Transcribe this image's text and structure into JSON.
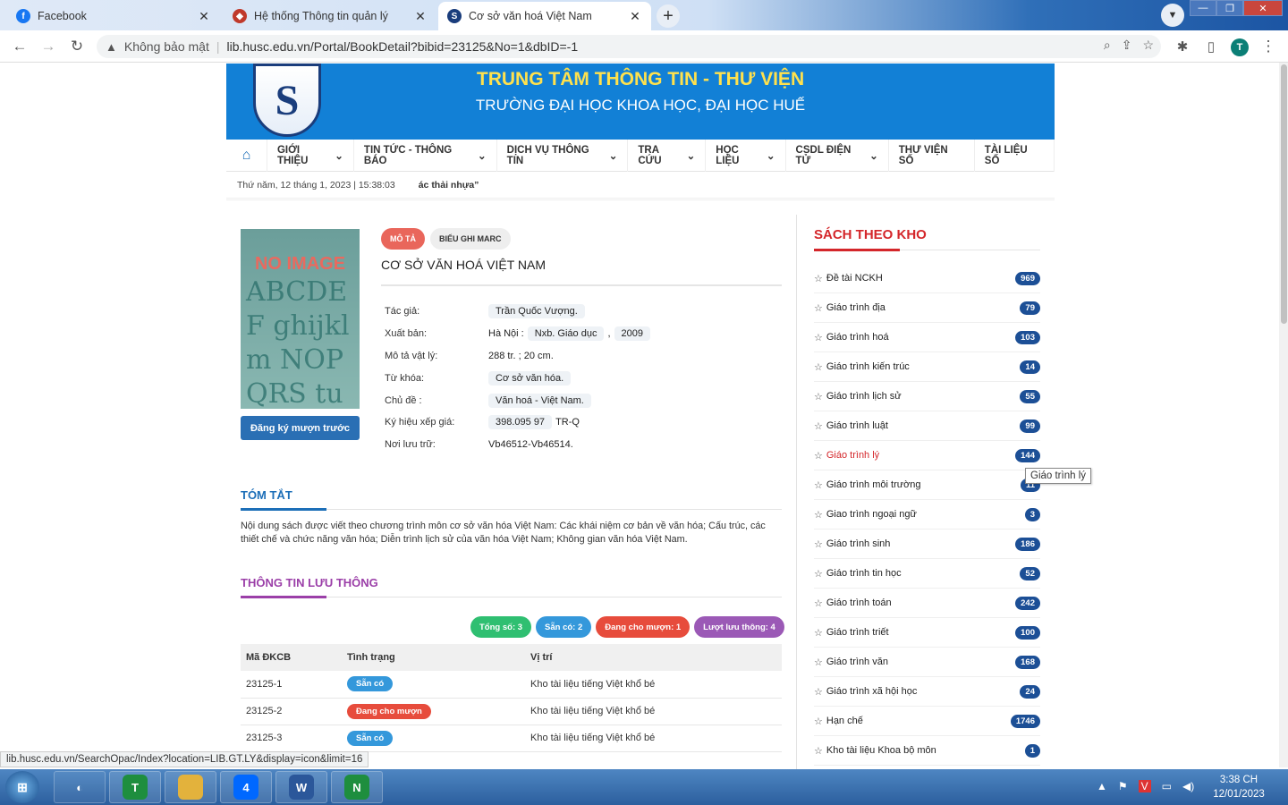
{
  "browser": {
    "tabs": [
      {
        "label": "Facebook",
        "icon": "facebook-icon"
      },
      {
        "label": "Hệ thống Thông tin quản lý",
        "icon": "shield-icon"
      },
      {
        "label": "Cơ sở văn hoá Việt Nam",
        "icon": "site-logo-icon"
      }
    ],
    "security_label": "Không bảo mật",
    "url": "lib.husc.edu.vn/Portal/BookDetail?bibid=23125&No=1&dbID=-1",
    "profile_initial": "T"
  },
  "header": {
    "title": "TRUNG TÂM THÔNG TIN - THƯ VIỆN",
    "subtitle": "TRƯỜNG ĐẠI HỌC KHOA HỌC, ĐẠI HỌC HUẾ"
  },
  "nav": [
    "GIỚI THIỆU",
    "TIN TỨC - THÔNG BÁO",
    "DỊCH VỤ THÔNG TIN",
    "TRA CỨU",
    "HỌC LIỆU",
    "CSDL ĐIỆN TỬ",
    "THƯ VIỆN SỐ",
    "TÀI LIỆU SỐ"
  ],
  "datebar": {
    "date": "Thứ năm, 12 tháng 1, 2023 | 15:38:03",
    "ticker": "ác thải nhựa”"
  },
  "book": {
    "cover_text": "NO IMAGE",
    "cover_letters": "ABCDEF ghijklm NOPQRS tuvwxyz",
    "reserve_button": "Đăng ký mượn trước",
    "tab_desc": "MÔ TẢ",
    "tab_marc": "BIỂU GHI MARC",
    "title": "CƠ SỞ VĂN HOÁ VIỆT NAM",
    "fields": [
      {
        "label": "Tác giả:",
        "parts": [
          {
            "text": "Trần Quốc Vượng.",
            "tag": true
          }
        ]
      },
      {
        "label": "Xuất bản:",
        "parts": [
          {
            "text": "Hà Nội :",
            "tag": false
          },
          {
            "text": "Nxb. Giáo dục",
            "tag": true
          },
          {
            "text": ",",
            "tag": false
          },
          {
            "text": "2009",
            "tag": true
          }
        ]
      },
      {
        "label": "Mô tả vật lý:",
        "parts": [
          {
            "text": "288 tr. ; 20 cm.",
            "tag": false
          }
        ]
      },
      {
        "label": "Từ khóa:",
        "parts": [
          {
            "text": "Cơ sở văn hóa.",
            "tag": true
          }
        ]
      },
      {
        "label": "Chủ đề :",
        "parts": [
          {
            "text": "Văn hoá - Việt Nam.",
            "tag": true
          }
        ]
      },
      {
        "label": "Ký hiệu xếp giá:",
        "parts": [
          {
            "text": "398.095 97",
            "tag": true
          },
          {
            "text": "TR-Q",
            "tag": false
          }
        ]
      },
      {
        "label": "Nơi lưu trữ:",
        "parts": [
          {
            "text": "Vb46512-Vb46514.",
            "tag": false
          }
        ]
      }
    ]
  },
  "summary": {
    "heading": "TÓM TẮT",
    "text": "Nội dung sách được viết theo chương trình môn cơ sở văn hóa Việt Nam: Các khái niệm cơ bản về văn hóa; Cấu trúc, các thiết chế và chức năng văn hóa; Diễn trình lịch sử của văn hóa Việt Nam; Không gian văn hóa Việt Nam."
  },
  "circulation": {
    "heading": "THÔNG TIN LƯU THÔNG",
    "stats": [
      {
        "label": "Tổng số: 3",
        "color": "#2fbf71"
      },
      {
        "label": "Sẵn có: 2",
        "color": "#3498db"
      },
      {
        "label": "Đang cho mượn: 1",
        "color": "#e74c3c"
      },
      {
        "label": "Lượt lưu thông: 4",
        "color": "#9b59b6"
      }
    ],
    "columns": [
      "Mã ĐKCB",
      "Tình trạng",
      "Vị trí"
    ],
    "rows": [
      {
        "code": "23125-1",
        "status": "Sẵn có",
        "status_color": "#3498db",
        "location": "Kho tài liệu tiếng Việt khổ bé"
      },
      {
        "code": "23125-2",
        "status": "Đang cho mượn",
        "status_color": "#e74c3c",
        "location": "Kho tài liệu tiếng Việt khổ bé"
      },
      {
        "code": "23125-3",
        "status": "Sẵn có",
        "status_color": "#3498db",
        "location": "Kho tài liệu tiếng Việt khổ bé"
      }
    ]
  },
  "sidebar": {
    "heading": "SÁCH THEO KHO",
    "items": [
      {
        "label": "Đề tài NCKH",
        "count": "969"
      },
      {
        "label": "Giáo trình địa",
        "count": "79"
      },
      {
        "label": "Giáo trình hoá",
        "count": "103"
      },
      {
        "label": "Giáo trình kiến trúc",
        "count": "14"
      },
      {
        "label": "Giáo trình lịch sử",
        "count": "55"
      },
      {
        "label": "Giáo trình luật",
        "count": "99"
      },
      {
        "label": "Giáo trình lý",
        "count": "144",
        "hover": true
      },
      {
        "label": "Giáo trình môi trường",
        "count": "11"
      },
      {
        "label": "Giao trình ngoại ngữ",
        "count": "3"
      },
      {
        "label": "Giáo trình sinh",
        "count": "186"
      },
      {
        "label": "Giáo trình tin học",
        "count": "52"
      },
      {
        "label": "Giáo trình toán",
        "count": "242"
      },
      {
        "label": "Giáo trình triết",
        "count": "100"
      },
      {
        "label": "Giáo trình văn",
        "count": "168"
      },
      {
        "label": "Giáo trình xã hội học",
        "count": "24"
      },
      {
        "label": "Hạn chế",
        "count": "1746"
      },
      {
        "label": "Kho tài liệu Khoa bộ môn",
        "count": "1"
      }
    ],
    "tooltip": "Giáo trình lý"
  },
  "status_url": "lib.husc.edu.vn/SearchOpac/Index?location=LIB.GT.LY&display=icon&limit=16",
  "taskbar": {
    "apps": [
      {
        "name": "browser-app",
        "badge": "T"
      },
      {
        "name": "file-explorer-app",
        "badge": ""
      },
      {
        "name": "zalo-app",
        "badge": "4"
      },
      {
        "name": "word-app",
        "badge": "W"
      },
      {
        "name": "browser-app-2",
        "badge": "N"
      }
    ],
    "time": "3:38 CH",
    "date": "12/01/2023"
  }
}
